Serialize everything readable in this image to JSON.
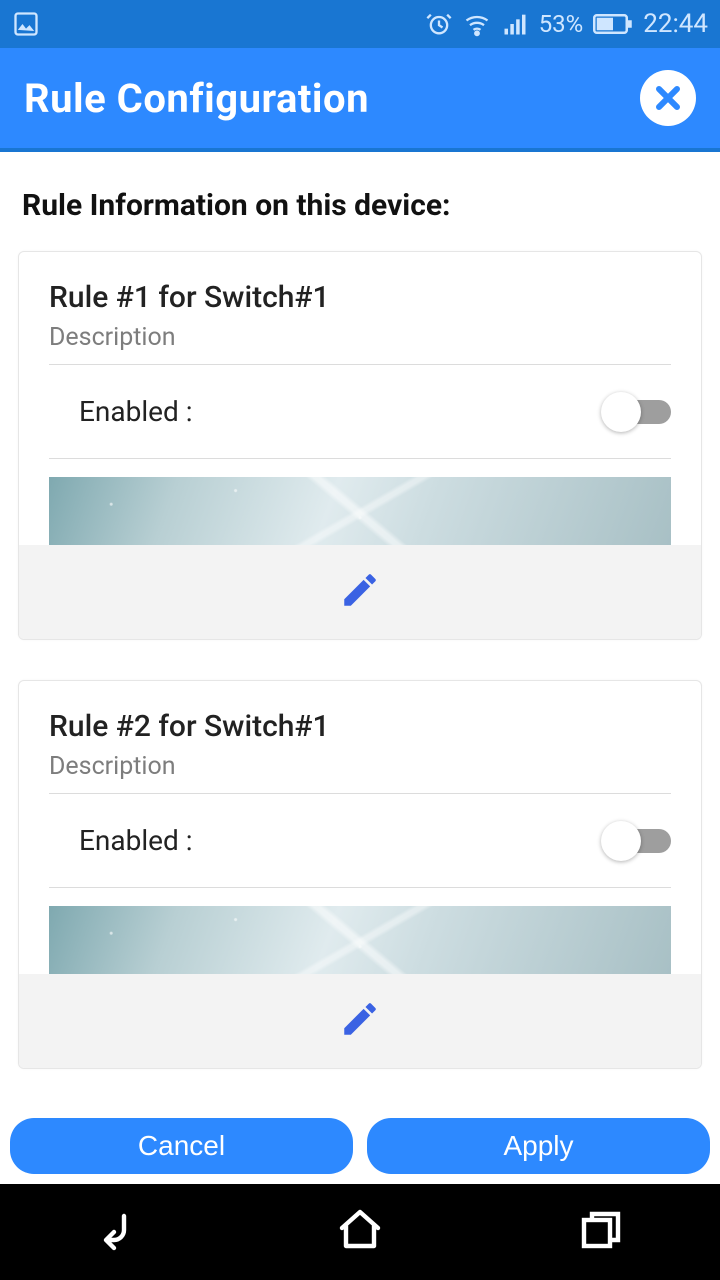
{
  "status": {
    "battery_pct": "53%",
    "time": "22:44"
  },
  "header": {
    "title": "Rule Configuration"
  },
  "section_title": "Rule Information on this device:",
  "rules": [
    {
      "title": "Rule #1 for Switch#1",
      "description": "Description",
      "enabled_label": "Enabled :",
      "enabled": false
    },
    {
      "title": "Rule #2 for Switch#1",
      "description": "Description",
      "enabled_label": "Enabled :",
      "enabled": false
    }
  ],
  "buttons": {
    "cancel": "Cancel",
    "apply": "Apply"
  }
}
